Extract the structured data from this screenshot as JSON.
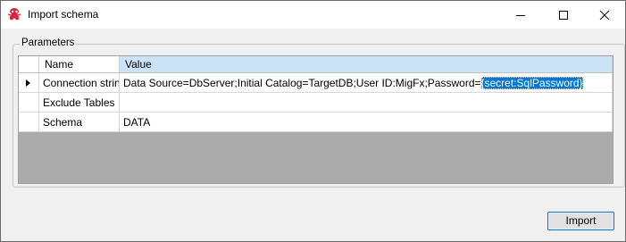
{
  "window": {
    "title": "Import schema"
  },
  "parameters": {
    "group_label": "Parameters",
    "columns": {
      "name": "Name",
      "value": "Value"
    },
    "rows": [
      {
        "name": "Connection string",
        "value_prefix": "Data Source=DbServer;Initial Catalog=TargetDB;User ID:MigFx;Password=",
        "value_highlight": "{secret:SqlPassword}",
        "selected": true
      },
      {
        "name": "Exclude Tables",
        "value_prefix": "",
        "value_highlight": ""
      },
      {
        "name": "Schema",
        "value_prefix": "DATA",
        "value_highlight": ""
      }
    ]
  },
  "actions": {
    "import_label": "Import"
  },
  "colors": {
    "accent": "#0078d7",
    "header_selected": "#cce3f7",
    "grid_background": "#ababab"
  }
}
